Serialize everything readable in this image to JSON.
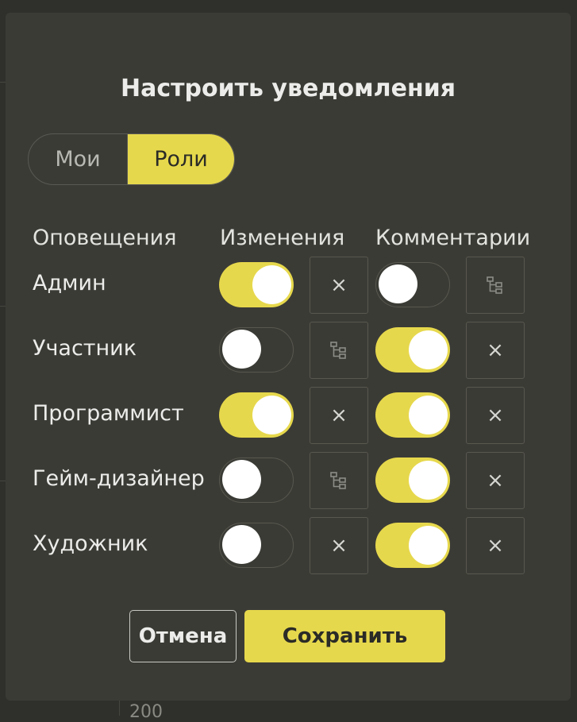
{
  "dialog": {
    "title": "Настроить уведомления",
    "tabs": {
      "mine": "Мои",
      "roles": "Роли",
      "active": "roles"
    },
    "columns": {
      "notifications": "Оповещения",
      "changes": "Изменения",
      "comments": "Комментарии"
    },
    "rows": [
      {
        "label": "Админ",
        "changes_on": true,
        "changes_icon": "close-icon",
        "comments_on": false,
        "comments_icon": "tree-icon"
      },
      {
        "label": "Участник",
        "changes_on": false,
        "changes_icon": "tree-icon",
        "comments_on": true,
        "comments_icon": "close-icon"
      },
      {
        "label": "Программист",
        "changes_on": true,
        "changes_icon": "close-icon",
        "comments_on": true,
        "comments_icon": "close-icon"
      },
      {
        "label": "Гейм-дизайнер",
        "changes_on": false,
        "changes_icon": "tree-icon",
        "comments_on": true,
        "comments_icon": "close-icon"
      },
      {
        "label": "Художник",
        "changes_on": false,
        "changes_icon": "close-icon",
        "comments_on": true,
        "comments_icon": "close-icon"
      }
    ],
    "buttons": {
      "cancel": "Отмена",
      "save": "Сохранить"
    },
    "close_glyph": "×"
  },
  "background": {
    "visible_number": "200"
  },
  "colors": {
    "accent": "#e6d84c",
    "modal_bg": "#3b3b36",
    "page_bg": "#2f302c"
  }
}
